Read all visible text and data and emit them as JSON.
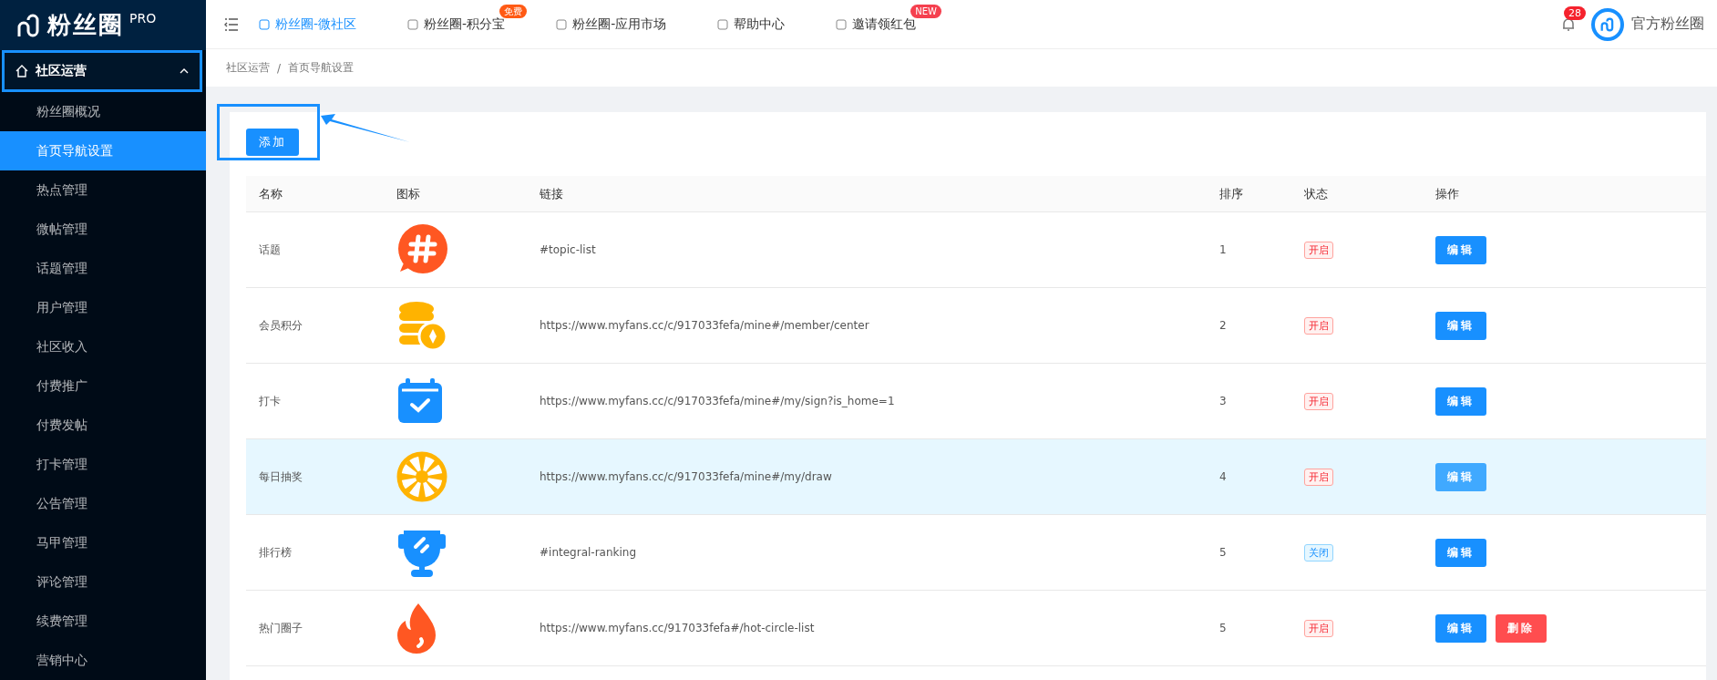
{
  "logo": {
    "text": "粉丝圈",
    "tag": "PRO"
  },
  "sidebar": {
    "group": {
      "label": "社区运营",
      "expanded": true
    },
    "items": [
      {
        "label": "粉丝圈概况",
        "selected": false
      },
      {
        "label": "首页导航设置",
        "selected": true
      },
      {
        "label": "热点管理",
        "selected": false
      },
      {
        "label": "微帖管理",
        "selected": false
      },
      {
        "label": "话题管理",
        "selected": false
      },
      {
        "label": "用户管理",
        "selected": false
      },
      {
        "label": "社区收入",
        "selected": false
      },
      {
        "label": "付费推广",
        "selected": false
      },
      {
        "label": "付费发帖",
        "selected": false
      },
      {
        "label": "打卡管理",
        "selected": false
      },
      {
        "label": "公告管理",
        "selected": false
      },
      {
        "label": "马甲管理",
        "selected": false
      },
      {
        "label": "评论管理",
        "selected": false
      },
      {
        "label": "续费管理",
        "selected": false
      },
      {
        "label": "营销中心",
        "selected": false
      }
    ]
  },
  "topnav": [
    {
      "label": "粉丝圈-微社区",
      "selected": true
    },
    {
      "label": "粉丝圈-积分宝",
      "selected": false,
      "badge": "免费",
      "color": "#ff5a14"
    },
    {
      "label": "粉丝圈-应用市场",
      "selected": false
    },
    {
      "label": "帮助中心",
      "selected": false
    },
    {
      "label": "邀请领红包",
      "selected": false,
      "badge": "NEW",
      "color": "#f5404f"
    }
  ],
  "notifications": {
    "count": "28"
  },
  "user": {
    "name": "官方粉丝圈"
  },
  "breadcrumb": [
    "社区运营",
    "/",
    "首页导航设置"
  ],
  "add_button": "添加",
  "table": {
    "columns": [
      "名称",
      "图标",
      "链接",
      "排序",
      "状态",
      "操作"
    ],
    "rows": [
      {
        "name": "话题",
        "link": "#topic-list",
        "order": "1",
        "status": "开启",
        "enabled": true,
        "highlighted": false,
        "actions": [
          "编辑"
        ]
      },
      {
        "name": "会员积分",
        "link": "https://www.myfans.cc/c/917033fefa/mine#/member/center",
        "order": "2",
        "status": "开启",
        "enabled": true,
        "highlighted": false,
        "actions": [
          "编辑"
        ]
      },
      {
        "name": "打卡",
        "link": "https://www.myfans.cc/c/917033fefa/mine#/my/sign?is_home=1",
        "order": "3",
        "status": "开启",
        "enabled": true,
        "highlighted": false,
        "actions": [
          "编辑"
        ]
      },
      {
        "name": "每日抽奖",
        "link": "https://www.myfans.cc/c/917033fefa/mine#/my/draw",
        "order": "4",
        "status": "开启",
        "enabled": true,
        "highlighted": true,
        "actions": [
          "编辑"
        ]
      },
      {
        "name": "排行榜",
        "link": "#integral-ranking",
        "order": "5",
        "status": "关闭",
        "enabled": false,
        "highlighted": false,
        "actions": [
          "编辑"
        ]
      },
      {
        "name": "热门圈子",
        "link": "https://www.myfans.cc/917033fefa#/hot-circle-list",
        "order": "5",
        "status": "开启",
        "enabled": true,
        "highlighted": false,
        "actions": [
          "编辑",
          "删除"
        ]
      }
    ]
  }
}
